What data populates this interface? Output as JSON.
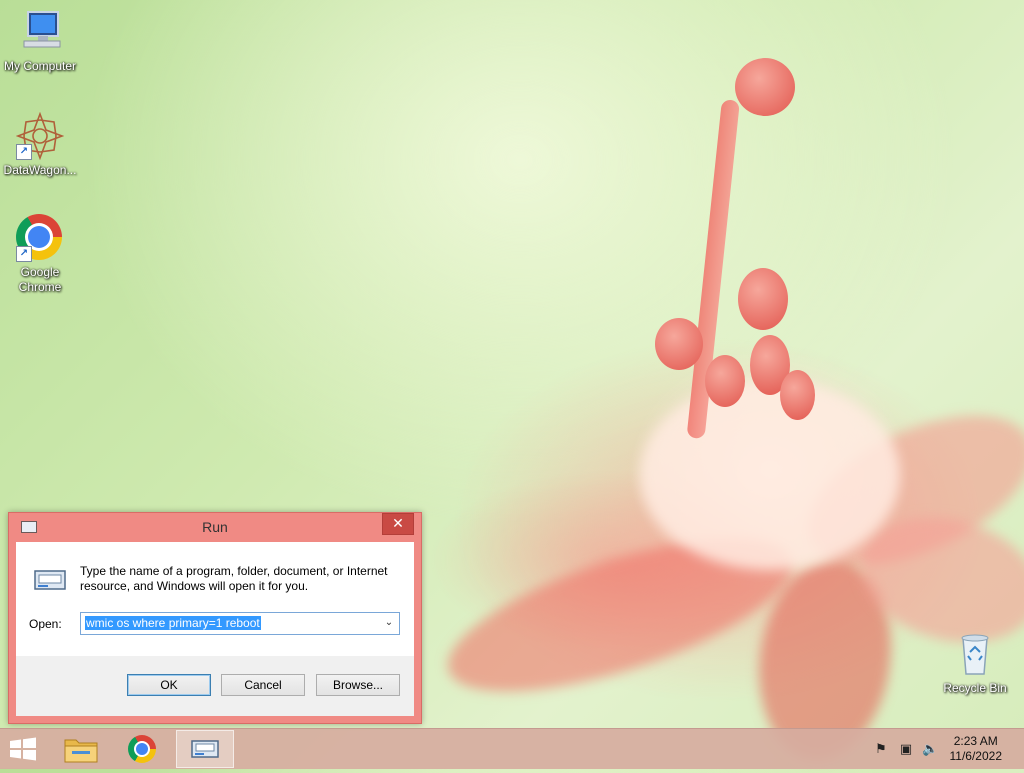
{
  "desktop": {
    "icons": [
      {
        "label": "My Computer"
      },
      {
        "label": "DataWagon..."
      },
      {
        "label_line1": "Google",
        "label_line2": "Chrome"
      },
      {
        "label": "Recycle Bin"
      }
    ],
    "shortcut_glyph": "↗"
  },
  "run_dialog": {
    "title": "Run",
    "close_glyph": "✕",
    "description": "Type the name of a program, folder, document, or Internet resource, and Windows will open it for you.",
    "open_label": "Open:",
    "open_value": "wmic os where primary=1 reboot",
    "dropdown_glyph": "⌄",
    "ok_label": "OK",
    "cancel_label": "Cancel",
    "browse_label": "Browse..."
  },
  "taskbar": {
    "clock_time": "2:23 AM",
    "clock_date": "11/6/2022",
    "tray": {
      "flag_glyph": "⚑",
      "network_glyph": "▣",
      "volume_glyph": "🔈"
    }
  },
  "colors": {
    "dialog_frame": "#f08a84",
    "close_button": "#c94a44",
    "selection": "#3399ff"
  }
}
